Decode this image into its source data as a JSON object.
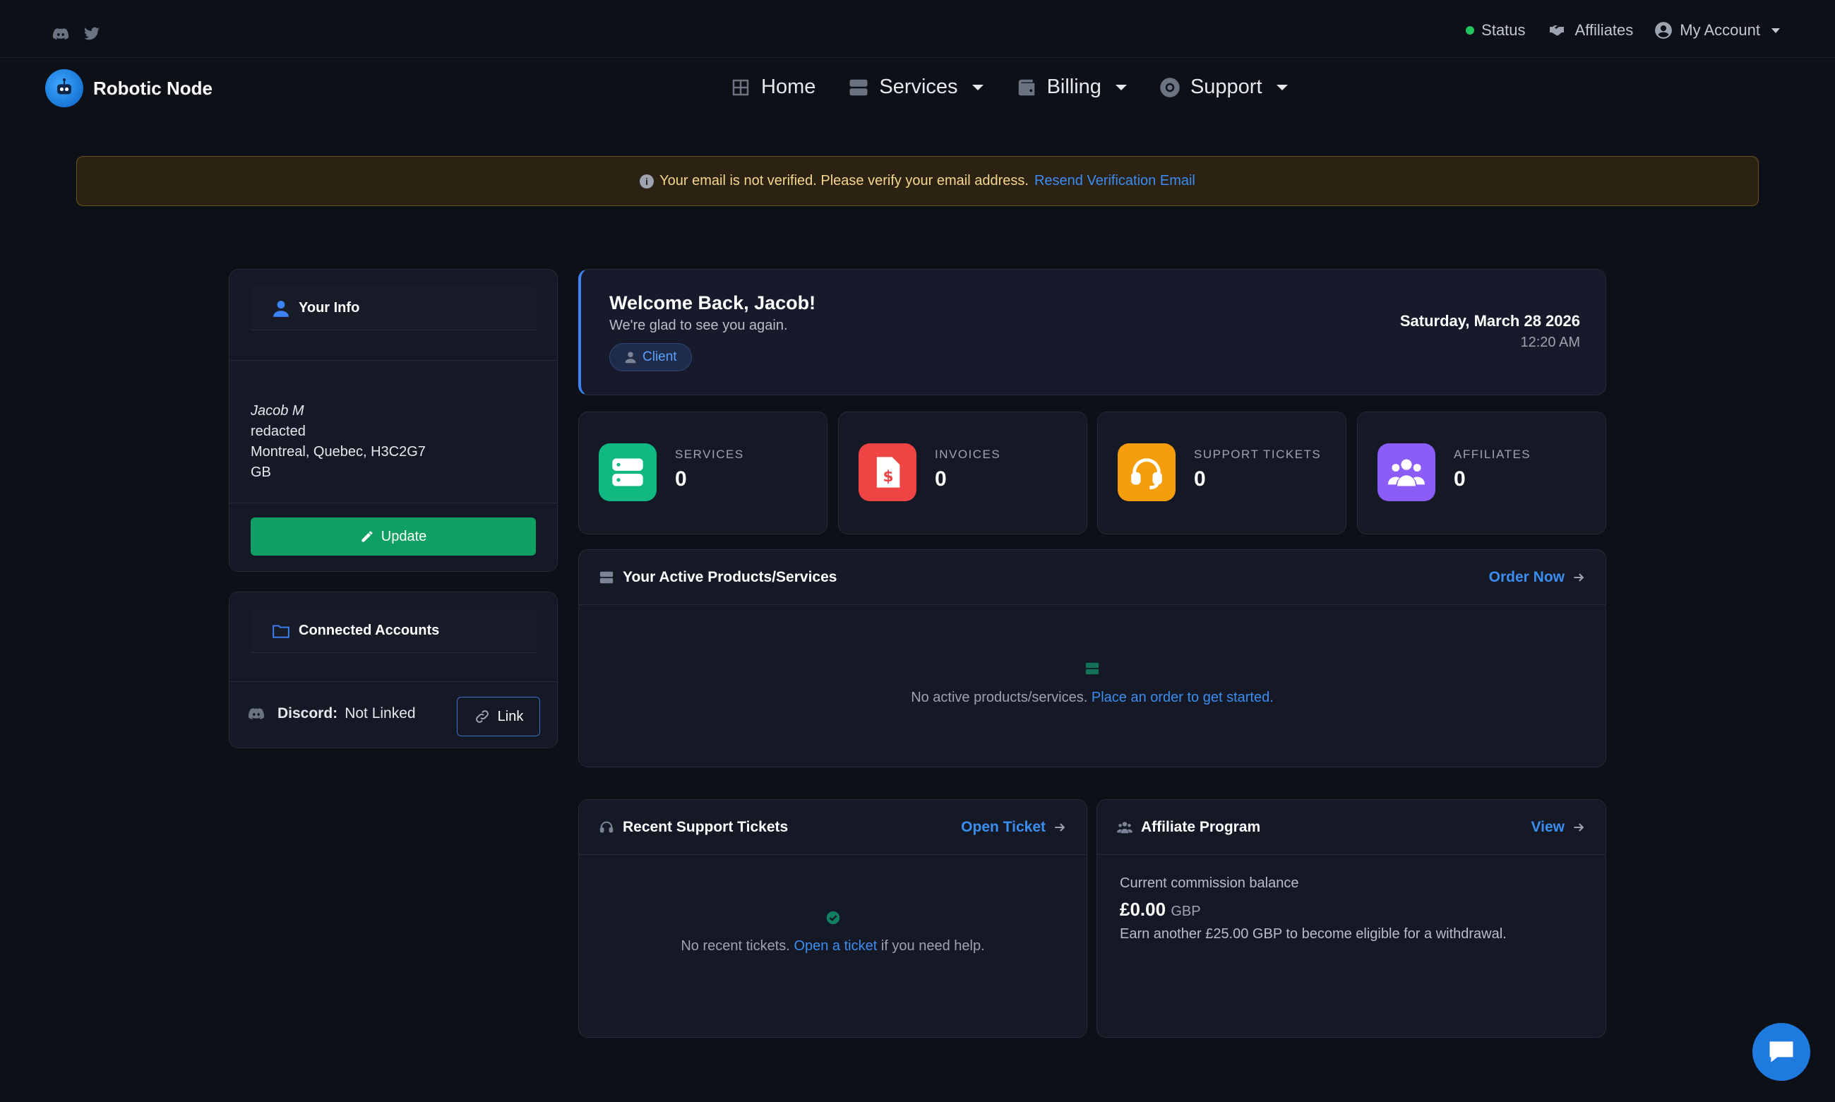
{
  "topbar": {
    "status_label": "Status",
    "affiliates_label": "Affiliates",
    "account_label": "My Account"
  },
  "brand": {
    "name": "Robotic Node"
  },
  "nav": {
    "home": "Home",
    "services": "Services",
    "billing": "Billing",
    "support": "Support"
  },
  "alert": {
    "message": "Your email is not verified. Please verify your email address.",
    "link": "Resend Verification Email"
  },
  "info_card": {
    "title": "Your Info",
    "name": "Jacob M",
    "line2": "redacted",
    "line3": "Montreal, Quebec, H3C2G7",
    "line4": "GB",
    "update_label": "Update"
  },
  "connected": {
    "title": "Connected Accounts",
    "discord_label": "Discord:",
    "discord_status": "Not Linked",
    "link_label": "Link"
  },
  "welcome": {
    "title": "Welcome Back, Jacob!",
    "subtitle": "We're glad to see you again.",
    "role": "Client",
    "date": "Saturday, March 28 2026",
    "time": "12:20 AM"
  },
  "stats": [
    {
      "label": "SERVICES",
      "value": "0",
      "color": "#10b981"
    },
    {
      "label": "INVOICES",
      "value": "0",
      "color": "#ef4444"
    },
    {
      "label": "SUPPORT TICKETS",
      "value": "0",
      "color": "#f59e0b"
    },
    {
      "label": "AFFILIATES",
      "value": "0",
      "color": "#8b5cf6"
    }
  ],
  "products": {
    "title": "Your Active Products/Services",
    "action": "Order Now",
    "empty_text": "No active products/services.",
    "empty_link": "Place an order to get started."
  },
  "tickets": {
    "title": "Recent Support Tickets",
    "action": "Open Ticket",
    "empty_text": "No recent tickets.",
    "empty_link": "Open a ticket",
    "empty_suffix": "if you need help."
  },
  "affiliate": {
    "title": "Affiliate Program",
    "action": "View",
    "balance_label": "Current commission balance",
    "balance": "£0.00",
    "currency": "GBP",
    "note": "Earn another £25.00 GBP to become eligible for a withdrawal."
  }
}
